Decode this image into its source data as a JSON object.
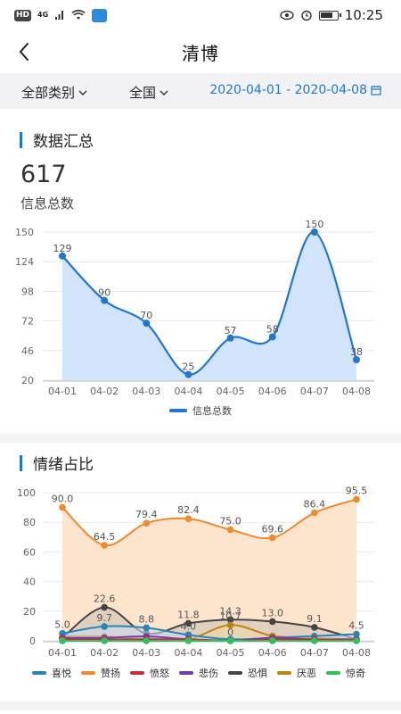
{
  "statusbar": {
    "hd": "HD",
    "signal": "4G",
    "time": "10:25"
  },
  "header": {
    "title": "清博"
  },
  "filters": {
    "category": "全部类别",
    "region": "全国",
    "date_range": "2020-04-01 - 2020-04-08"
  },
  "summary": {
    "section_title": "数据汇总",
    "total": "617",
    "total_label": "信息总数"
  },
  "emotion": {
    "section_title": "情绪占比"
  },
  "colors": {
    "accent": "#1f77d0",
    "area": "#cfe3fb"
  },
  "chart_data": [
    {
      "type": "area",
      "categories": [
        "04-01",
        "04-02",
        "04-03",
        "04-04",
        "04-05",
        "04-06",
        "04-07",
        "04-08"
      ],
      "series": [
        {
          "name": "信息总数",
          "color": "#1f77d0",
          "values": [
            129,
            90,
            70,
            25,
            57,
            58,
            150,
            38
          ]
        }
      ],
      "y_ticks": [
        20,
        46,
        72,
        98,
        124,
        150
      ],
      "ylim": [
        20,
        150
      ],
      "legend": "bottom",
      "grid": true
    },
    {
      "type": "area",
      "categories": [
        "04-01",
        "04-02",
        "04-03",
        "04-04",
        "04-05",
        "04-06",
        "04-07",
        "04-08"
      ],
      "series": [
        {
          "name": "喜悦",
          "color": "#2b84b6",
          "values": [
            5.0,
            9.7,
            8.8,
            4.0,
            1.0,
            2.0,
            3.2,
            4.5
          ]
        },
        {
          "name": "赞扬",
          "color": "#f08a2c",
          "values": [
            90.0,
            64.5,
            79.4,
            82.4,
            75.0,
            69.6,
            86.4,
            95.5
          ]
        },
        {
          "name": "愤怒",
          "color": "#d0293a",
          "values": [
            1.0,
            1.0,
            1.0,
            1.0,
            0.0,
            1.0,
            1.0,
            0.5
          ]
        },
        {
          "name": "悲伤",
          "color": "#6a3fb8",
          "values": [
            2.0,
            2.0,
            3.0,
            1.0,
            0.0,
            2.0,
            1.0,
            1.0
          ]
        },
        {
          "name": "恐惧",
          "color": "#454545",
          "values": [
            2.0,
            22.6,
            5.0,
            11.8,
            14.3,
            13.0,
            9.1,
            1.0
          ]
        },
        {
          "name": "厌恶",
          "color": "#b8860b",
          "values": [
            3.0,
            3.0,
            1.0,
            1.0,
            10.7,
            3.3,
            2.0,
            1.0
          ]
        },
        {
          "name": "惊奇",
          "color": "#2ec25a",
          "values": [
            0.0,
            0.0,
            0.0,
            0.0,
            0.0,
            0.0,
            0.0,
            0.0
          ]
        }
      ],
      "y_ticks": [
        0,
        20,
        40,
        60,
        80,
        100
      ],
      "ylim": [
        0,
        100
      ],
      "visible_value_labels": {
        "喜悦": [
          {
            "i": 0,
            "text": "5.0"
          },
          {
            "i": 1,
            "text": "9.7"
          },
          {
            "i": 3,
            "text": "4.0"
          },
          {
            "i": 7,
            "text": "4.5"
          }
        ],
        "赞扬": [
          {
            "i": 0,
            "text": "90.0"
          },
          {
            "i": 1,
            "text": "64.5"
          },
          {
            "i": 2,
            "text": "79.4"
          },
          {
            "i": 3,
            "text": "82.4"
          },
          {
            "i": 4,
            "text": "75.0"
          },
          {
            "i": 5,
            "text": "69.6"
          },
          {
            "i": 6,
            "text": "86.4"
          },
          {
            "i": 7,
            "text": "95.5"
          }
        ],
        "恐惧": [
          {
            "i": 1,
            "text": "22.6"
          },
          {
            "i": 2,
            "text": "8.8"
          },
          {
            "i": 3,
            "text": "11.8"
          },
          {
            "i": 4,
            "text": "14.3"
          },
          {
            "i": 5,
            "text": "13.0"
          },
          {
            "i": 6,
            "text": "9.1"
          }
        ],
        "厌恶": [
          {
            "i": 4,
            "text": "10.7"
          },
          {
            "i": 4,
            "text": "0"
          }
        ]
      },
      "legend": "bottom"
    }
  ]
}
